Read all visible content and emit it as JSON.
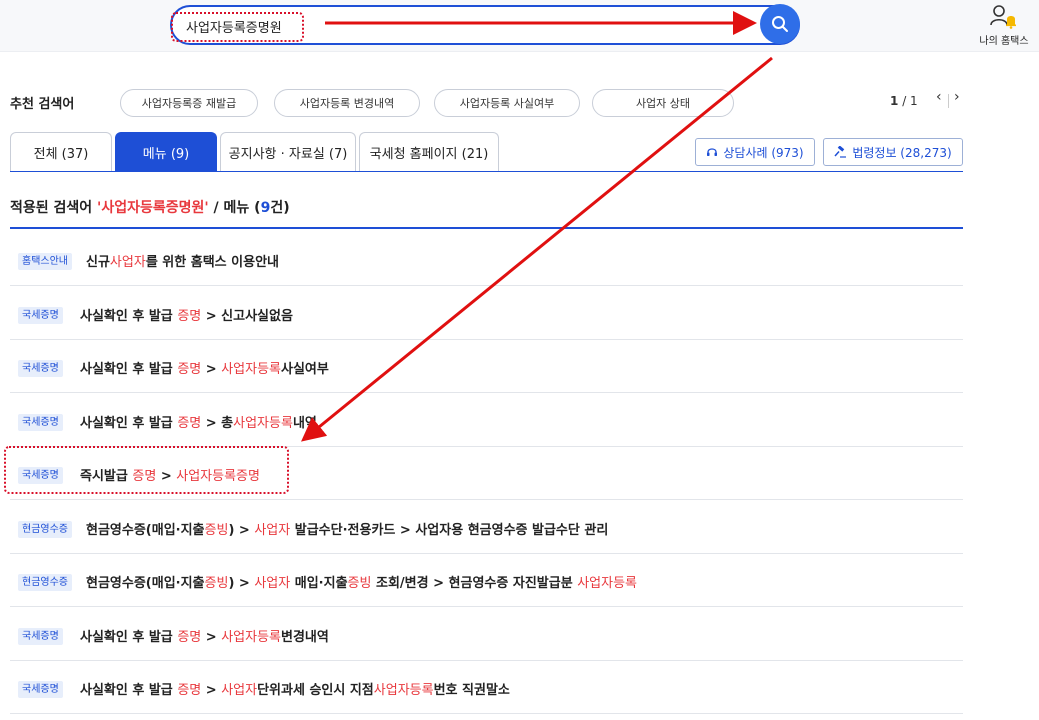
{
  "header": {
    "search_value": "사업자등록증명원",
    "my_hometax_label": "나의 홈택스"
  },
  "recommend": {
    "title": "추천 검색어",
    "chips": [
      "사업자등록증 재발급",
      "사업자등록 변경내역",
      "사업자등록 사실여부",
      "사업자 상태"
    ],
    "page_current": "1",
    "page_total": "/ 1",
    "prev": "‹",
    "next": "›"
  },
  "tabs": [
    {
      "label": "전체 (37)"
    },
    {
      "label": "메뉴 (9)"
    },
    {
      "label": "공지사항 · 자료실 (7)"
    },
    {
      "label": "국세청 홈페이지 (21)"
    }
  ],
  "side_buttons": {
    "counsel": "상담사례 (973)",
    "law": "법령정보 (28,273)"
  },
  "applied": {
    "prefix": "적용된 검색어 ",
    "keyword": "'사업자등록증명원'",
    "mid": " / 메뉴 (",
    "count": "9",
    "suffix": "건)"
  },
  "results": [
    {
      "badge": "홈택스안내",
      "parts": [
        [
          "신규",
          false
        ],
        [
          "사업자",
          true
        ],
        [
          "를 위한 홈택스 이용안내",
          false
        ]
      ]
    },
    {
      "badge": "국세증명",
      "parts": [
        [
          "사실확인 후 발급 ",
          false
        ],
        [
          "증명",
          true
        ],
        [
          " > 신고사실없음",
          false
        ]
      ]
    },
    {
      "badge": "국세증명",
      "parts": [
        [
          "사실확인 후 발급 ",
          false
        ],
        [
          "증명",
          true
        ],
        [
          " > ",
          false
        ],
        [
          "사업자등록",
          true
        ],
        [
          "사실여부",
          false
        ]
      ]
    },
    {
      "badge": "국세증명",
      "parts": [
        [
          "사실확인 후 발급 ",
          false
        ],
        [
          "증명",
          true
        ],
        [
          " > 총",
          false
        ],
        [
          "사업자등록",
          true
        ],
        [
          "내역",
          false
        ]
      ]
    },
    {
      "badge": "국세증명",
      "parts": [
        [
          "즉시발급 ",
          false
        ],
        [
          "증명",
          true
        ],
        [
          " > ",
          false
        ],
        [
          "사업자등록증명",
          true
        ]
      ]
    },
    {
      "badge": "현금영수증",
      "parts": [
        [
          "현금영수증(매입·지출",
          false
        ],
        [
          "증빙",
          true
        ],
        [
          ") > ",
          false
        ],
        [
          "사업자",
          true
        ],
        [
          " 발급수단·전용카드 > 사업자용 현금영수증 발급수단 관리",
          false
        ]
      ]
    },
    {
      "badge": "현금영수증",
      "parts": [
        [
          "현금영수증(매입·지출",
          false
        ],
        [
          "증빙",
          true
        ],
        [
          ") > ",
          false
        ],
        [
          "사업자",
          true
        ],
        [
          " 매입·지출",
          false
        ],
        [
          "증빙",
          true
        ],
        [
          " 조회/변경 > 현금영수증 자진발급분 ",
          false
        ],
        [
          "사업자등록",
          true
        ]
      ]
    },
    {
      "badge": "국세증명",
      "parts": [
        [
          "사실확인 후 발급 ",
          false
        ],
        [
          "증명",
          true
        ],
        [
          " > ",
          false
        ],
        [
          "사업자등록",
          true
        ],
        [
          "변경내역",
          false
        ]
      ]
    },
    {
      "badge": "국세증명",
      "parts": [
        [
          "사실확인 후 발급 ",
          false
        ],
        [
          "증명",
          true
        ],
        [
          " > ",
          false
        ],
        [
          "사업자",
          true
        ],
        [
          "단위과세 승인시 지점",
          false
        ],
        [
          "사업자등록",
          true
        ],
        [
          "번호 직권말소",
          false
        ]
      ]
    }
  ],
  "colors": {
    "primary": "#1e4fd6",
    "highlight": "#e8383d",
    "annotation": "#e01010"
  },
  "icons": {
    "search": "search-icon",
    "my_hometax": "user-bell-icon",
    "counsel": "headset-icon",
    "law": "gavel-icon"
  }
}
